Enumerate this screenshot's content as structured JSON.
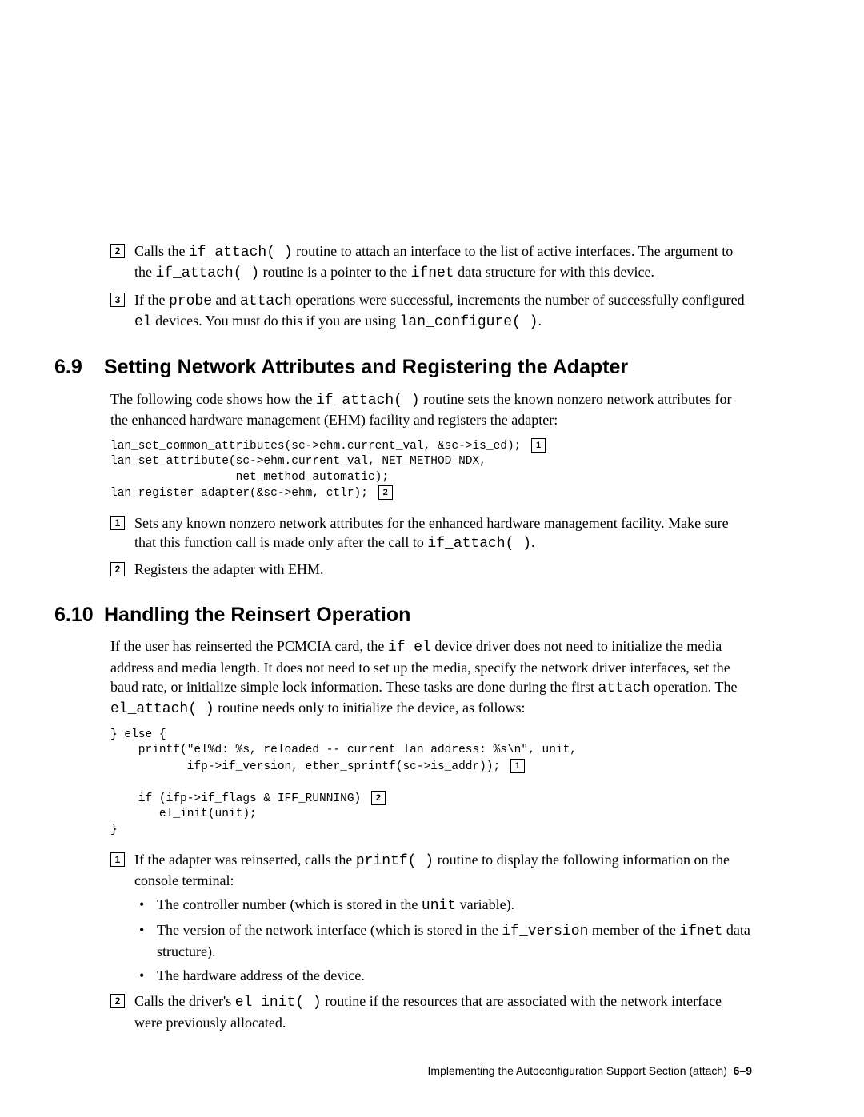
{
  "top_list": [
    {
      "n": "2",
      "text_parts": [
        {
          "t": "Calls the "
        },
        {
          "t": "if_attach( )",
          "mono": true
        },
        {
          "t": " routine to attach an interface to the list of active interfaces. The argument to the "
        },
        {
          "t": "if_attach( )",
          "mono": true
        },
        {
          "t": " routine is a pointer to the "
        },
        {
          "t": "ifnet",
          "mono": true
        },
        {
          "t": " data structure for with this device."
        }
      ]
    },
    {
      "n": "3",
      "text_parts": [
        {
          "t": "If the "
        },
        {
          "t": "probe",
          "mono": true
        },
        {
          "t": " and "
        },
        {
          "t": "attach",
          "mono": true
        },
        {
          "t": " operations were successful, increments the number of successfully configured "
        },
        {
          "t": "el",
          "mono": true
        },
        {
          "t": " devices. You must do this if you are using "
        },
        {
          "t": "lan_configure( )",
          "mono": true
        },
        {
          "t": "."
        }
      ]
    }
  ],
  "sec69": {
    "num": "6.9",
    "title": "Setting Network Attributes and Registering the Adapter",
    "intro_parts": [
      {
        "t": "The following code shows how the "
      },
      {
        "t": "if_attach( )",
        "mono": true
      },
      {
        "t": " routine sets the known nonzero network attributes for the enhanced hardware management (EHM) facility and registers the adapter:"
      }
    ],
    "code": {
      "l1": "lan_set_common_attributes(sc->ehm.current_val, &sc->is_ed); ",
      "n1": "1",
      "l2": "lan_set_attribute(sc->ehm.current_val, NET_METHOD_NDX,",
      "l3": "                  net_method_automatic);",
      "l4": "lan_register_adapter(&sc->ehm, ctlr); ",
      "n2": "2"
    },
    "items": [
      {
        "n": "1",
        "text_parts": [
          {
            "t": "Sets any known nonzero network attributes for the enhanced hardware management facility. Make sure that this function call is made only after the call to "
          },
          {
            "t": "if_attach( )",
            "mono": true
          },
          {
            "t": "."
          }
        ]
      },
      {
        "n": "2",
        "text_parts": [
          {
            "t": "Registers the adapter with EHM."
          }
        ]
      }
    ]
  },
  "sec610": {
    "num": "6.10",
    "title": "Handling the Reinsert Operation",
    "intro_parts": [
      {
        "t": "If the user has reinserted the PCMCIA card, the "
      },
      {
        "t": "if_el",
        "mono": true
      },
      {
        "t": " device driver does not need to initialize the media address and media length. It does not need to set up the media, specify the network driver interfaces, set the baud rate, or initialize simple lock information. These tasks are done during the first "
      },
      {
        "t": "attach",
        "mono": true
      },
      {
        "t": " operation. The "
      },
      {
        "t": "el_attach( )",
        "mono": true
      },
      {
        "t": " routine needs only to initialize the device, as follows:"
      }
    ],
    "code": {
      "l1": "} else {",
      "l2": "    printf(\"el%d: %s, reloaded -- current lan address: %s\\n\", unit,",
      "l3": "           ifp->if_version, ether_sprintf(sc->is_addr)); ",
      "n1": "1",
      "blank": " ",
      "l4": "    if (ifp->if_flags & IFF_RUNNING) ",
      "n2": "2",
      "l5": "       el_init(unit);",
      "l6": "}"
    },
    "items": [
      {
        "n": "1",
        "text_parts": [
          {
            "t": "If the adapter was reinserted, calls the "
          },
          {
            "t": "printf( )",
            "mono": true
          },
          {
            "t": " routine to display the following information on the console terminal:"
          }
        ],
        "bullets": [
          [
            {
              "t": "The controller number (which is stored in the "
            },
            {
              "t": "unit",
              "mono": true
            },
            {
              "t": " variable)."
            }
          ],
          [
            {
              "t": "The version of the network interface (which is stored in the "
            },
            {
              "t": "if_version",
              "mono": true
            },
            {
              "t": " member of the "
            },
            {
              "t": "ifnet",
              "mono": true
            },
            {
              "t": " data structure)."
            }
          ],
          [
            {
              "t": "The hardware address of the device."
            }
          ]
        ]
      },
      {
        "n": "2",
        "text_parts": [
          {
            "t": "Calls the driver's "
          },
          {
            "t": "el_init( )",
            "mono": true
          },
          {
            "t": " routine if the resources that are associated with the network interface were previously allocated."
          }
        ]
      }
    ]
  },
  "footer": {
    "text": "Implementing the Autoconfiguration Support Section (attach)",
    "page": "6–9"
  }
}
